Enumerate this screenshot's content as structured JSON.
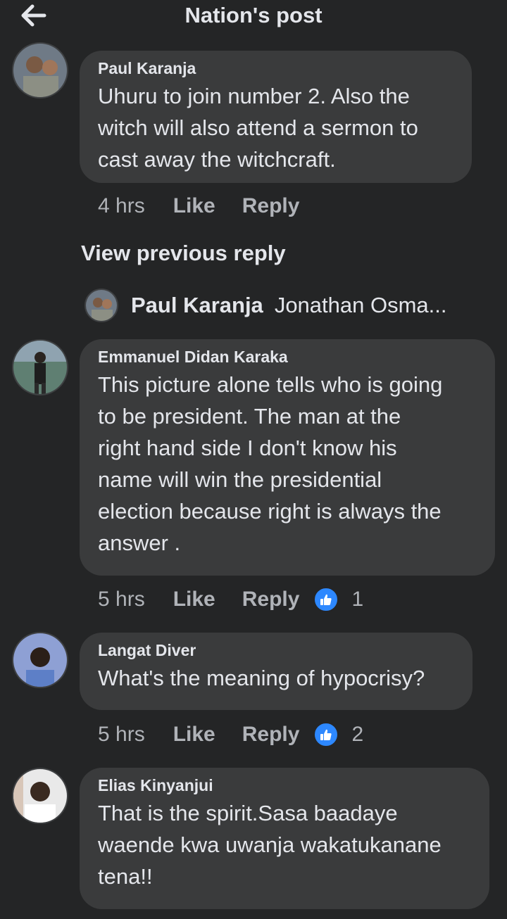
{
  "header": {
    "title": "Nation's post"
  },
  "view_previous_label": "View previous reply",
  "reply_preview": {
    "name": "Paul Karanja",
    "text": "Jonathan Osma..."
  },
  "comments": [
    {
      "name": "Paul Karanja",
      "lines": [
        "Uhuru to join number 2. Also the",
        "witch will also attend a sermon to",
        "cast away the witchcraft."
      ],
      "time": "4 hrs",
      "like": "Like",
      "reply": "Reply",
      "reactions": ""
    },
    {
      "name": "Emmanuel Didan Karaka",
      "lines": [
        "This picture alone tells who is going",
        "to be president.  The man at the",
        "right hand side I don't know his",
        "name will win the presidential",
        "election because right is always the",
        "answer ."
      ],
      "time": "5 hrs",
      "like": "Like",
      "reply": "Reply",
      "reactions": "1"
    },
    {
      "name": "Langat Diver",
      "lines": [
        "What's the meaning of hypocrisy?"
      ],
      "time": "5 hrs",
      "like": "Like",
      "reply": "Reply",
      "reactions": "2"
    },
    {
      "name": "Elias Kinyanjui",
      "lines": [
        "That is the spirit.Sasa baadaye",
        "waende kwa uwanja wakatukanane",
        "tena!!"
      ],
      "time": "",
      "like": "",
      "reply": "",
      "reactions": ""
    }
  ],
  "colors": {
    "background": "#242526",
    "bubble": "#3a3b3c",
    "accent": "#2d88ff",
    "muted": "#b0b3b8"
  }
}
